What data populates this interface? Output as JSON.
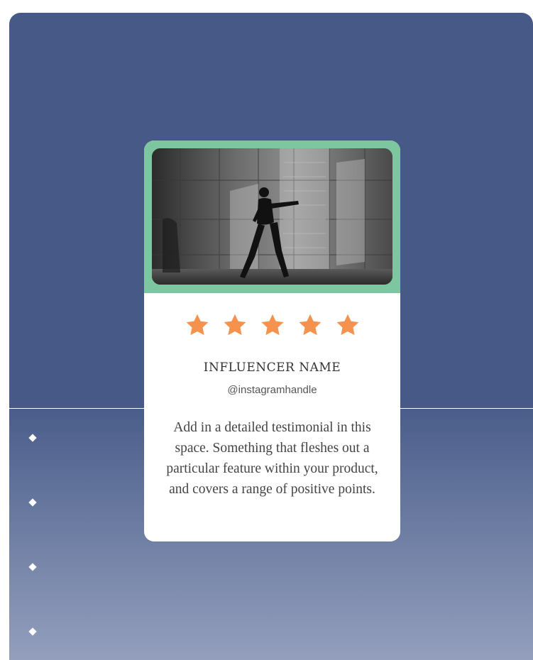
{
  "card": {
    "rating": 5,
    "rating_max": 5,
    "name": "INFLUENCER NAME",
    "handle": "@instagramhandle",
    "testimonial": "Add in a detailed testimonial in this space. Something that fleshes out a particular feature within your product, and covers a range of positive points."
  },
  "bullets_count": 4,
  "colors": {
    "panel_top": "#475a87",
    "frame_accent": "#7dc6a0",
    "star": "#f5924e",
    "card_bg": "#ffffff"
  }
}
